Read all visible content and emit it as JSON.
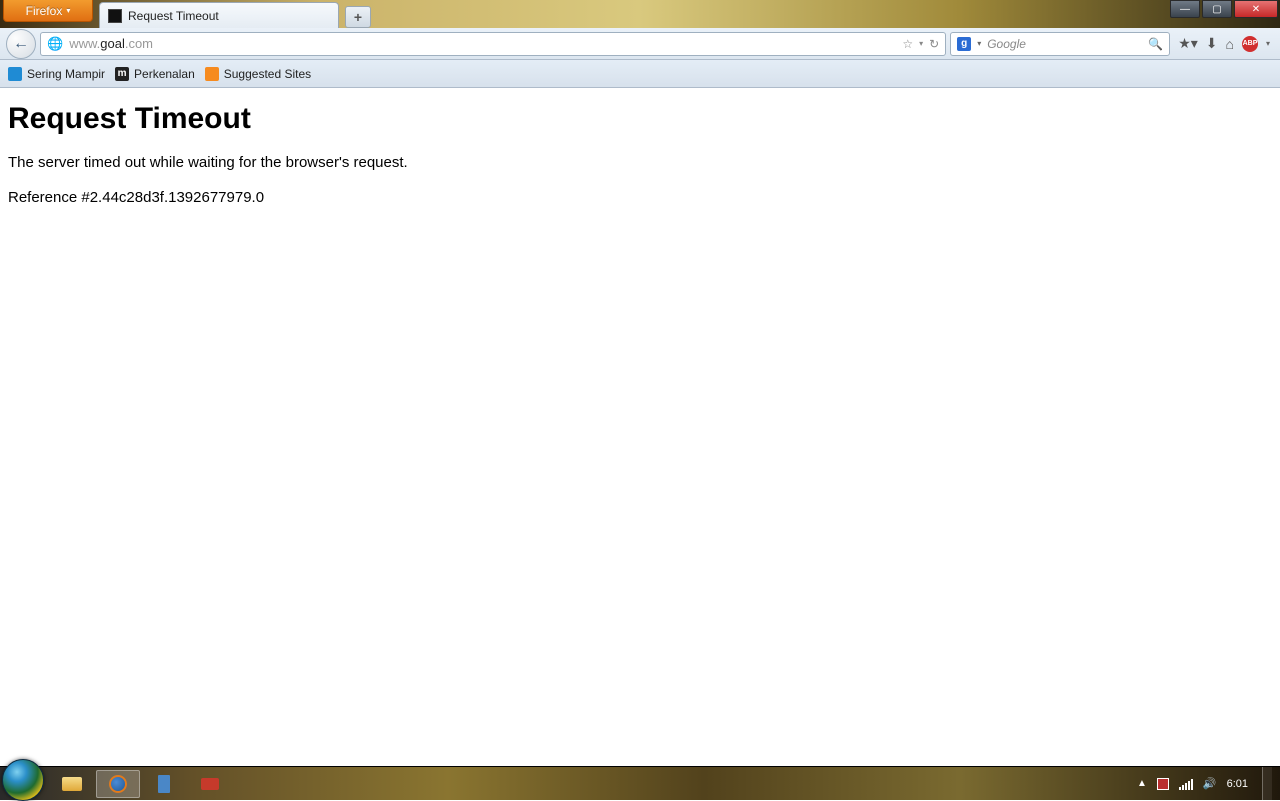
{
  "browser": {
    "menu_label": "Firefox",
    "tab_title": "Request Timeout",
    "url_prefix": "www.",
    "url_host": "goal",
    "url_suffix": ".com",
    "search_placeholder": "Google"
  },
  "bookmarks": [
    {
      "label": "Sering Mampir"
    },
    {
      "label": "Perkenalan"
    },
    {
      "label": "Suggested Sites"
    }
  ],
  "page": {
    "heading": "Request Timeout",
    "body": "The server timed out while waiting for the browser's request.",
    "reference": "Reference #2.44c28d3f.1392677979.0"
  },
  "taskbar": {
    "clock": "6:01"
  }
}
